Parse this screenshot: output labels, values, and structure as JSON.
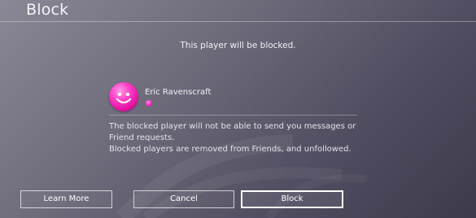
{
  "dialog": {
    "title": "Block",
    "message": "This player will be blocked."
  },
  "player": {
    "name": "Eric Ravenscraft"
  },
  "info": {
    "line1": "The blocked player will not be able to send you messages or Friend requests.",
    "line2": "Blocked players are removed from Friends, and unfollowed."
  },
  "buttons": {
    "learn_more": "Learn More",
    "cancel": "Cancel",
    "block": "Block"
  },
  "colors": {
    "accent": "#ff3fc8",
    "background": "#6f6c7c"
  },
  "icons": {
    "avatar": "smiley-face-icon",
    "status": "status-dot-icon"
  }
}
